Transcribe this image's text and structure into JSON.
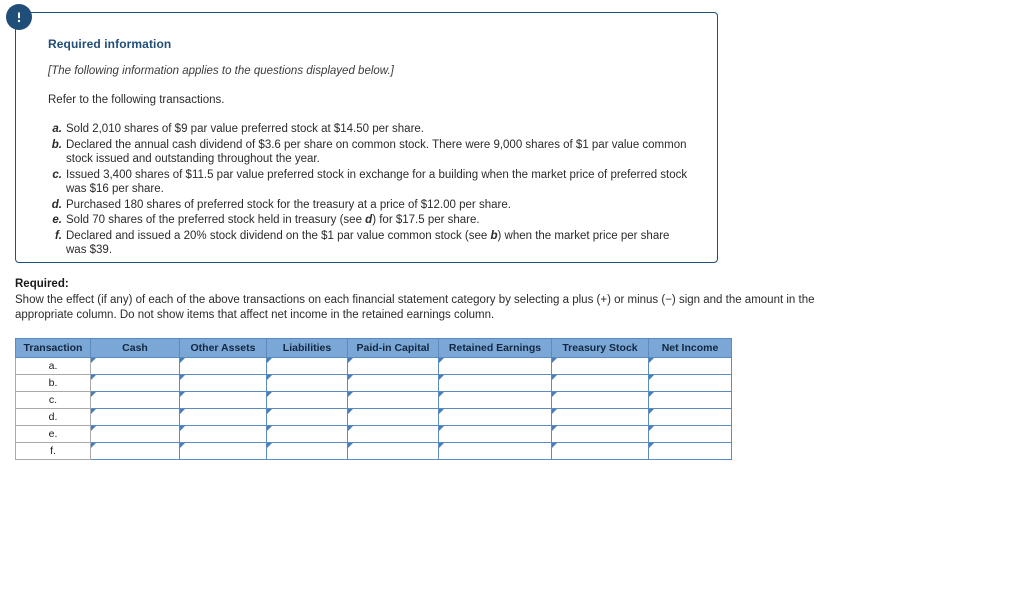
{
  "callout": {
    "icon": "exclamation-circle-icon",
    "title": "Required information",
    "italic_note": "[The following information applies to the questions displayed below.]",
    "intro": "Refer to the following transactions.",
    "transactions": [
      {
        "letter": "a.",
        "text": "Sold 2,010 shares of $9 par value preferred stock at $14.50 per share."
      },
      {
        "letter": "b.",
        "text": "Declared the annual cash dividend of $3.6 per share on common stock. There were 9,000 shares of $1 par value common stock issued and outstanding throughout the year."
      },
      {
        "letter": "c.",
        "text": "Issued 3,400 shares of $11.5 par value preferred stock in exchange for a building when the market price of preferred stock was $16 per share."
      },
      {
        "letter": "d.",
        "text": "Purchased 180 shares of preferred stock for the treasury at a price of $12.00 per share."
      },
      {
        "letter": "e_pre",
        "text": ""
      },
      {
        "letter": "f_pre",
        "text": ""
      }
    ],
    "transaction_e_part1": "Sold 70 shares of the preferred stock held in treasury (see ",
    "transaction_e_bold": "d",
    "transaction_e_part2": ") for $17.5 per share.",
    "transaction_e_letter": "e.",
    "transaction_f_part1": "Declared and issued a 20% stock dividend on the $1 par value common stock (see ",
    "transaction_f_bold": "b",
    "transaction_f_part2": ") when the market price per share was $39.",
    "transaction_f_letter": "f."
  },
  "required": {
    "label": "Required:",
    "text": "Show the effect (if any) of each of the above transactions on each financial statement category by selecting a plus (+) or minus (−) sign and the amount in the appropriate column. Do not show items that affect net income in the retained earnings column."
  },
  "table": {
    "headers": [
      "Transaction",
      "Cash",
      "Other Assets",
      "Liabilities",
      "Paid-in Capital",
      "Retained Earnings",
      "Treasury Stock",
      "Net Income"
    ],
    "rows": [
      {
        "label": "a.",
        "values": [
          "",
          "",
          "",
          "",
          "",
          "",
          ""
        ]
      },
      {
        "label": "b.",
        "values": [
          "",
          "",
          "",
          "",
          "",
          "",
          ""
        ]
      },
      {
        "label": "c.",
        "values": [
          "",
          "",
          "",
          "",
          "",
          "",
          ""
        ]
      },
      {
        "label": "d.",
        "values": [
          "",
          "",
          "",
          "",
          "",
          "",
          ""
        ]
      },
      {
        "label": "e.",
        "values": [
          "",
          "",
          "",
          "",
          "",
          "",
          ""
        ]
      },
      {
        "label": "f.",
        "values": [
          "",
          "",
          "",
          "",
          "",
          "",
          ""
        ]
      }
    ]
  },
  "colors": {
    "accent_navy": "#1f4e79",
    "header_blue": "#7ba7d7",
    "cell_border_blue": "#5b8cc0",
    "marker_blue": "#4a7ebb"
  }
}
